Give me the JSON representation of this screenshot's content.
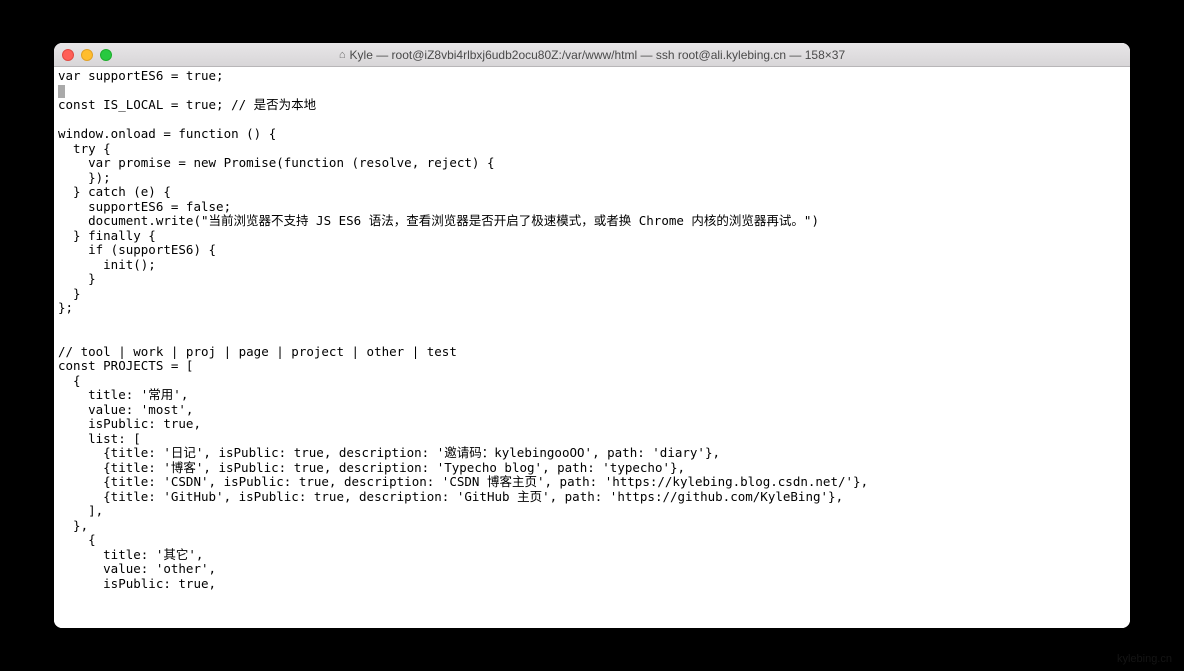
{
  "window": {
    "title": "Kyle — root@iZ8vbi4rlbxj6udb2ocu80Z:/var/www/html — ssh root@ali.kylebing.cn — 158×37"
  },
  "code": {
    "line1": "var supportES6 = true;",
    "line2_cursor": "",
    "line3": "const IS_LOCAL = true; // 是否为本地",
    "line4": "",
    "line5": "window.onload = function () {",
    "line6": "  try {",
    "line7": "    var promise = new Promise(function (resolve, reject) {",
    "line8": "    });",
    "line9": "  } catch (e) {",
    "line10": "    supportES6 = false;",
    "line11": "    document.write(\"当前浏览器不支持 JS ES6 语法，查看浏览器是否开启了极速模式，或者换 Chrome 内核的浏览器再试。\")",
    "line12": "  } finally {",
    "line13": "    if (supportES6) {",
    "line14": "      init();",
    "line15": "    }",
    "line16": "  }",
    "line17": "};",
    "line18": "",
    "line19": "",
    "line20": "// tool | work | proj | page | project | other | test",
    "line21": "const PROJECTS = [",
    "line22": "  {",
    "line23": "    title: '常用',",
    "line24": "    value: 'most',",
    "line25": "    isPublic: true,",
    "line26": "    list: [",
    "line27": "      {title: '日记', isPublic: true, description: '邀请码：kylebingooOO', path: 'diary'},",
    "line28": "      {title: '博客', isPublic: true, description: 'Typecho blog', path: 'typecho'},",
    "line29": "      {title: 'CSDN', isPublic: true, description: 'CSDN 博客主页', path: 'https://kylebing.blog.csdn.net/'},",
    "line30": "      {title: 'GitHub', isPublic: true, description: 'GitHub 主页', path: 'https://github.com/KyleBing'},",
    "line31": "    ],",
    "line32": "  },",
    "line33": "    {",
    "line34": "      title: '其它',",
    "line35": "      value: 'other',",
    "line36": "      isPublic: true,"
  },
  "watermark": "kylebing.cn"
}
